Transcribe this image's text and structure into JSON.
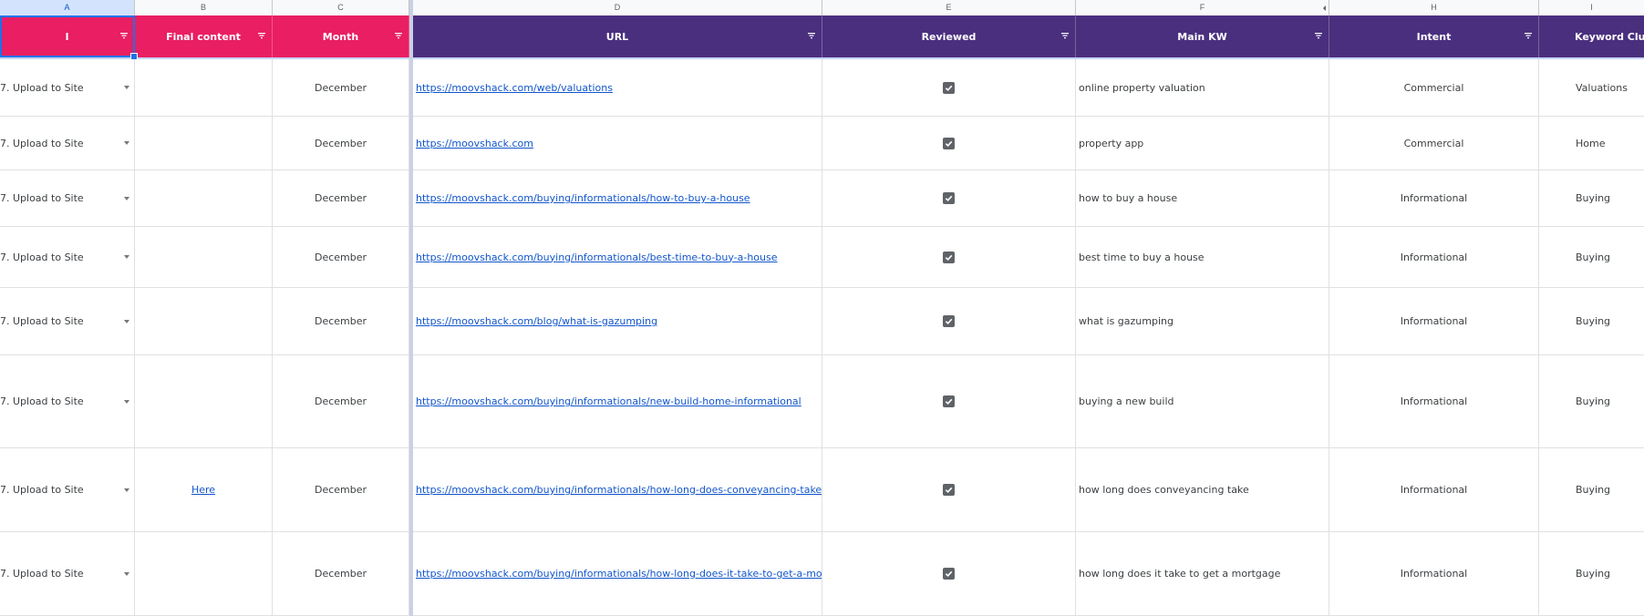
{
  "column_letters": [
    "A",
    "B",
    "C",
    "D",
    "E",
    "F",
    "H",
    "I"
  ],
  "headers": {
    "status": "I",
    "final_content": "Final content",
    "month": "Month",
    "url": "URL",
    "reviewed": "Reviewed",
    "main_kw": "Main KW",
    "intent": "Intent",
    "keyword_cluster": "Keyword Clust"
  },
  "colors": {
    "pink_header": "#e91e63",
    "purple_header": "#4a2f7f",
    "link": "#1155cc",
    "selection": "#1a73e8"
  },
  "rows": [
    {
      "status": "7. Upload to Site",
      "final_content": "",
      "month": "December",
      "url": "https://moovshack.com/web/valuations",
      "reviewed": true,
      "main_kw": "online property valuation",
      "intent": "Commercial",
      "cluster": "Valuations"
    },
    {
      "status": "7. Upload to Site",
      "final_content": "",
      "month": "December",
      "url": "https://moovshack.com",
      "reviewed": true,
      "main_kw": "property app",
      "intent": "Commercial",
      "cluster": "Home"
    },
    {
      "status": "7. Upload to Site",
      "final_content": "",
      "month": "December",
      "url": "https://moovshack.com/buying/informationals/how-to-buy-a-house",
      "reviewed": true,
      "main_kw": "how to buy a house",
      "intent": "Informational",
      "cluster": "Buying"
    },
    {
      "status": "7. Upload to Site",
      "final_content": "",
      "month": "December",
      "url": "https://moovshack.com/buying/informationals/best-time-to-buy-a-house",
      "reviewed": true,
      "main_kw": "best time to buy a house",
      "intent": "Informational",
      "cluster": "Buying"
    },
    {
      "status": "7. Upload to Site",
      "final_content": "",
      "month": "December",
      "url": "https://moovshack.com/blog/what-is-gazumping",
      "reviewed": true,
      "main_kw": "what is gazumping",
      "intent": "Informational",
      "cluster": "Buying"
    },
    {
      "status": "7. Upload to Site",
      "final_content": "",
      "month": "December",
      "url": "https://moovshack.com/buying/informationals/new-build-home-informational",
      "reviewed": true,
      "main_kw": "buying a new build",
      "intent": "Informational",
      "cluster": "Buying"
    },
    {
      "status": "7. Upload to Site",
      "final_content": "Here",
      "month": "December",
      "url": "https://moovshack.com/buying/informationals/how-long-does-conveyancing-take",
      "reviewed": true,
      "main_kw": "how long does conveyancing take",
      "intent": "Informational",
      "cluster": "Buying"
    },
    {
      "status": "7. Upload to Site",
      "final_content": "",
      "month": "December",
      "url": "https://moovshack.com/buying/informationals/how-long-does-it-take-to-get-a-mortgage",
      "reviewed": true,
      "main_kw": "how long does it take to get a mortgage",
      "intent": "Informational",
      "cluster": "Buying"
    }
  ]
}
